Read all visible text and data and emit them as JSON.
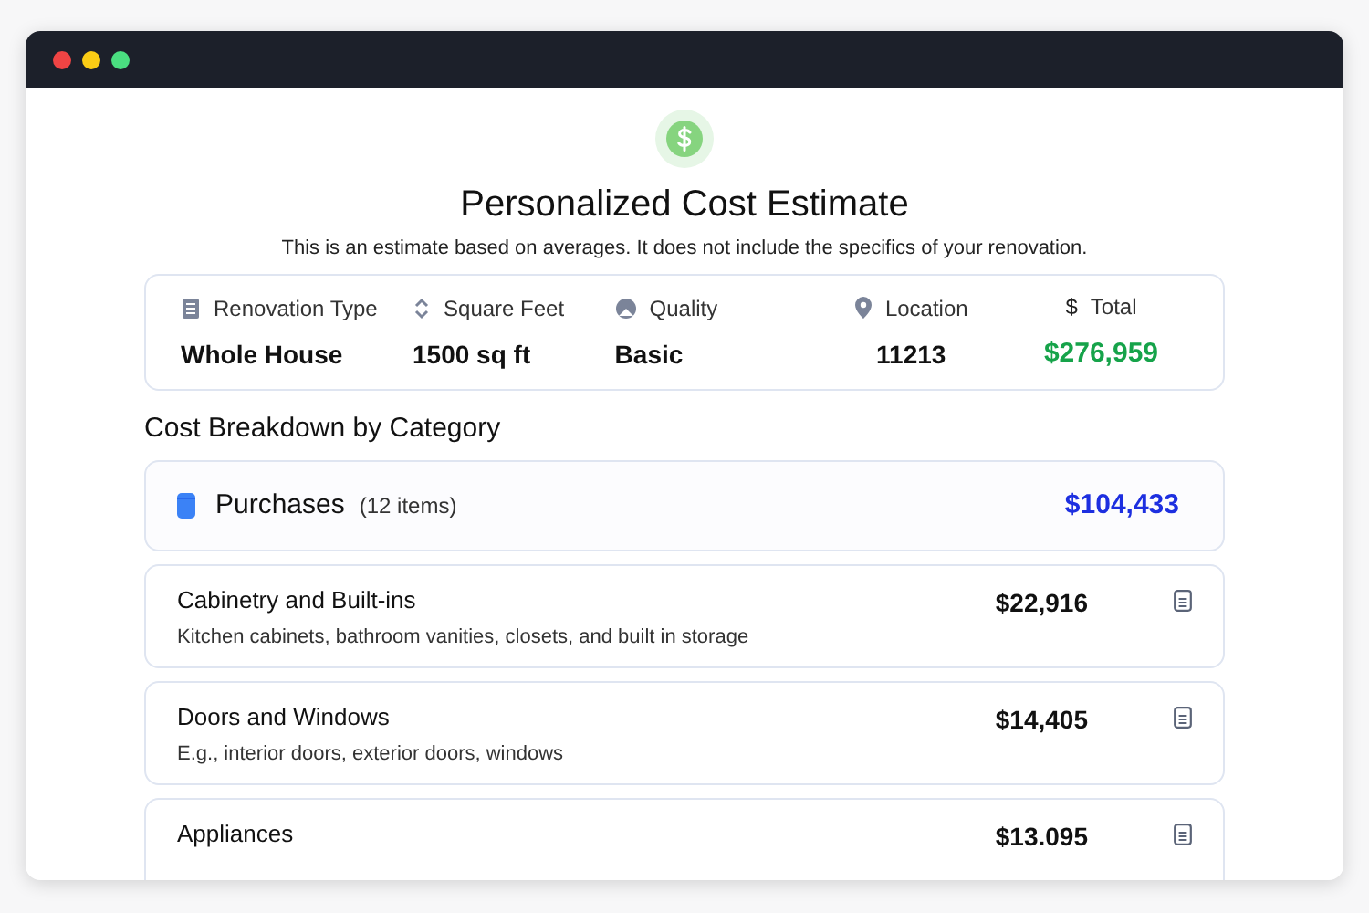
{
  "header": {
    "title": "Personalized Cost Estimate",
    "subtitle": "This is an estimate based on averages. It does not include the specifics of your renovation."
  },
  "summary": [
    {
      "kind": "document",
      "label": "Renovation Type",
      "value": "Whole House",
      "highlight": false
    },
    {
      "kind": "chevrons",
      "label": "Square Feet",
      "value": "1500 sq ft",
      "highlight": false
    },
    {
      "kind": "gauge",
      "label": "Quality",
      "value": "Basic",
      "highlight": false
    },
    {
      "kind": "pin",
      "label": "Location",
      "value": "11213",
      "highlight": false
    },
    {
      "kind": "symbol",
      "symbol": "$",
      "label": "Total",
      "value": "$276,959",
      "highlight": true
    }
  ],
  "breakdown": {
    "heading": "Cost Breakdown by Category",
    "group": {
      "label": "Purchases",
      "count": "(12 items)",
      "total": "$104,433"
    },
    "items": [
      {
        "name": "Cabinetry and Built-ins",
        "description": "Kitchen cabinets, bathroom vanities, closets, and built in storage",
        "cost": "$22,916"
      },
      {
        "name": "Doors and Windows",
        "description": "E.g., interior doors, exterior doors, windows",
        "cost": "$14,405"
      },
      {
        "name": "Appliances",
        "cost": "$13.095"
      }
    ]
  }
}
